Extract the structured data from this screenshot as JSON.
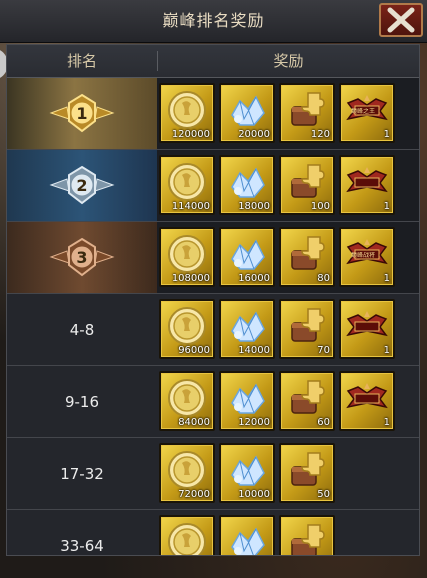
{
  "title": "巅峰排名奖励",
  "header": {
    "rank": "排名",
    "reward": "奖励"
  },
  "rows": [
    {
      "rank": "1",
      "items": [
        {
          "icon": "gold-coin-icon",
          "qty": "120000"
        },
        {
          "icon": "diamond-icon",
          "qty": "20000"
        },
        {
          "icon": "puzzle-chest-icon",
          "qty": "120"
        },
        {
          "icon": "title-badge-icon",
          "qty": "1",
          "label": "巅峰之王"
        }
      ]
    },
    {
      "rank": "2",
      "items": [
        {
          "icon": "gold-coin-icon",
          "qty": "114000"
        },
        {
          "icon": "diamond-icon",
          "qty": "18000"
        },
        {
          "icon": "puzzle-chest-icon",
          "qty": "100"
        },
        {
          "icon": "title-badge-icon",
          "qty": "1"
        }
      ]
    },
    {
      "rank": "3",
      "items": [
        {
          "icon": "gold-coin-icon",
          "qty": "108000"
        },
        {
          "icon": "diamond-icon",
          "qty": "16000"
        },
        {
          "icon": "puzzle-chest-icon",
          "qty": "80"
        },
        {
          "icon": "title-badge-icon",
          "qty": "1",
          "label": "巅峰战将"
        }
      ]
    },
    {
      "rank": "4-8",
      "items": [
        {
          "icon": "gold-coin-icon",
          "qty": "96000"
        },
        {
          "icon": "diamond-icon",
          "qty": "14000"
        },
        {
          "icon": "puzzle-chest-icon",
          "qty": "70"
        },
        {
          "icon": "title-badge-icon",
          "qty": "1"
        }
      ]
    },
    {
      "rank": "9-16",
      "items": [
        {
          "icon": "gold-coin-icon",
          "qty": "84000"
        },
        {
          "icon": "diamond-icon",
          "qty": "12000"
        },
        {
          "icon": "puzzle-chest-icon",
          "qty": "60"
        },
        {
          "icon": "title-badge-icon",
          "qty": "1"
        }
      ]
    },
    {
      "rank": "17-32",
      "items": [
        {
          "icon": "gold-coin-icon",
          "qty": "72000"
        },
        {
          "icon": "diamond-icon",
          "qty": "10000"
        },
        {
          "icon": "puzzle-chest-icon",
          "qty": "50"
        }
      ]
    },
    {
      "rank": "33-64",
      "items": [
        {
          "icon": "gold-coin-icon",
          "qty": ""
        },
        {
          "icon": "diamond-icon",
          "qty": ""
        },
        {
          "icon": "puzzle-chest-icon",
          "qty": ""
        }
      ]
    }
  ],
  "colors": {
    "item_bg": "#d4ac25",
    "rank1": "#8b7443",
    "rank2": "#2c5477",
    "rank3": "#6f4a30"
  }
}
